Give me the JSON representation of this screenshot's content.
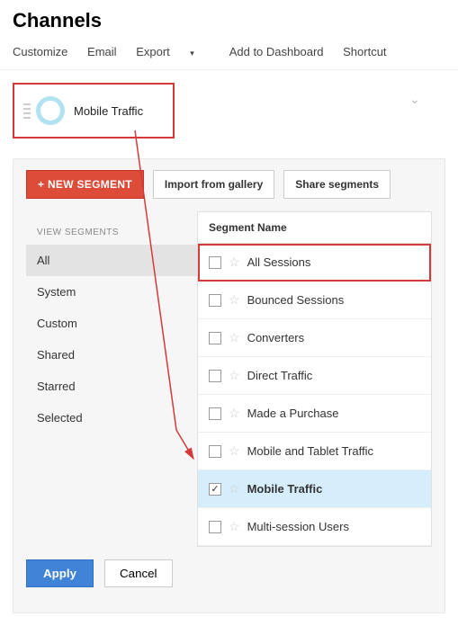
{
  "page": {
    "title": "Channels"
  },
  "toolbar": {
    "customize": "Customize",
    "email": "Email",
    "export": "Export",
    "add_dashboard": "Add to Dashboard",
    "shortcut": "Shortcut"
  },
  "chip": {
    "label": "Mobile Traffic"
  },
  "panel": {
    "new_segment": "+ NEW SEGMENT",
    "import_gallery": "Import from gallery",
    "share_segments": "Share segments"
  },
  "sidebar": {
    "header": "VIEW SEGMENTS",
    "items": [
      "All",
      "System",
      "Custom",
      "Shared",
      "Starred",
      "Selected"
    ]
  },
  "list": {
    "header": "Segment Name",
    "rows": [
      {
        "label": "All Sessions",
        "checked": false,
        "highlight": true
      },
      {
        "label": "Bounced Sessions",
        "checked": false
      },
      {
        "label": "Converters",
        "checked": false
      },
      {
        "label": "Direct Traffic",
        "checked": false
      },
      {
        "label": "Made a Purchase",
        "checked": false
      },
      {
        "label": "Mobile and Tablet Traffic",
        "checked": false
      },
      {
        "label": "Mobile Traffic",
        "checked": true,
        "selected": true
      },
      {
        "label": "Multi-session Users",
        "checked": false
      }
    ]
  },
  "footer": {
    "apply": "Apply",
    "cancel": "Cancel"
  }
}
